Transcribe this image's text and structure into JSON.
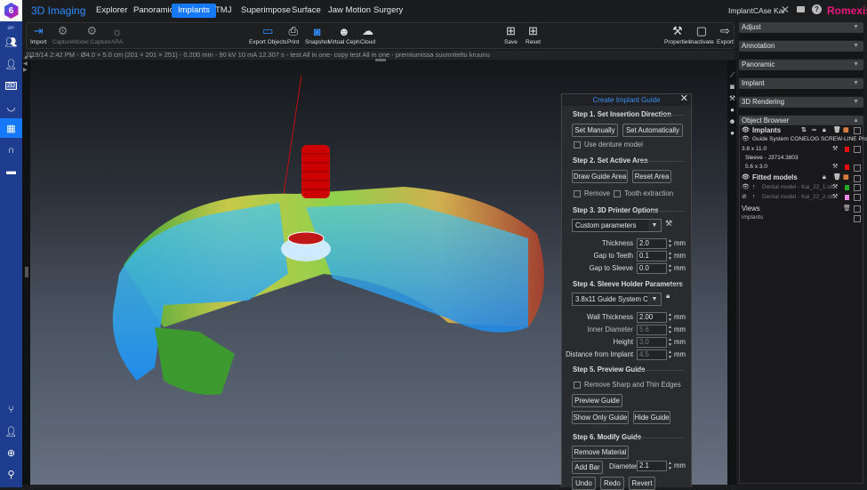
{
  "app": {
    "title": "3D Imaging",
    "case_name": "ImplantCAse Kai",
    "brand": "Romexis",
    "accent_color": "#1677ff",
    "brand_color": "#e8177d"
  },
  "nav_tabs": [
    {
      "label": "Explorer",
      "active": false
    },
    {
      "label": "Panoramic",
      "active": false
    },
    {
      "label": "Implants",
      "active": true
    },
    {
      "label": "TMJ",
      "active": false
    },
    {
      "label": "Superimpose",
      "active": false
    },
    {
      "label": "Surface",
      "active": false
    },
    {
      "label": "Jaw Motion",
      "active": false
    },
    {
      "label": "Surgery",
      "active": false
    }
  ],
  "rail_icons": [
    "lock-icon",
    "patients-icon",
    "patient-icon",
    "2d-icon",
    "panoramic-icon",
    "3d-icon",
    "arch-icon",
    "model-icon",
    "chair-icon",
    "doctor-icon",
    "login-icon",
    "user-settings-icon"
  ],
  "toolbar": {
    "left": [
      {
        "label": "Import",
        "icon": "import-icon",
        "enabled": true
      },
      {
        "label": "Capture",
        "icon": "capture-icon",
        "enabled": false
      },
      {
        "label": "Model Capture",
        "icon": "model-capture-icon",
        "enabled": false
      },
      {
        "label": "ARA",
        "icon": "ara-icon",
        "enabled": false
      }
    ],
    "middle": [
      {
        "label": "Export Objects",
        "icon": "export-objects-icon"
      },
      {
        "label": "Print",
        "icon": "print-icon"
      },
      {
        "label": "Snapshot",
        "icon": "snapshot-icon"
      },
      {
        "label": "Virtual Ceph",
        "icon": "virtual-ceph-icon"
      },
      {
        "label": "Cloud",
        "icon": "cloud-icon"
      }
    ],
    "save": {
      "label": "Save"
    },
    "reset": {
      "label": "Reset"
    },
    "right": [
      {
        "label": "Properties",
        "icon": "properties-icon"
      },
      {
        "label": "Inactivate",
        "icon": "inactivate-icon"
      },
      {
        "label": "Export",
        "icon": "export-icon"
      }
    ]
  },
  "info_line": "2/19/14 2:42 PM - Ø4.0 × 5.0 cm (201 × 201 × 251) - 0.200 mm - 90 kV 10 mA 12.307 s - test All in one- copy test All in one - premiumissa suunniteltu kruunu",
  "dialog": {
    "title": "Create Implant Guide",
    "step1": {
      "title": "Step 1. Set Insertion Direction",
      "set_manually": "Set Manually",
      "set_automatically": "Set Automatically",
      "use_denture_model": "Use denture model",
      "use_denture_checked": false
    },
    "step2": {
      "title": "Step 2. Set Active Area",
      "draw_guide_area": "Draw Guide Area",
      "reset_area": "Reset Area",
      "remove": "Remove",
      "remove_checked": false,
      "tooth_extraction": "Tooth extraction",
      "tooth_extraction_checked": false
    },
    "step3": {
      "title": "Step 3. 3D Printer Options",
      "preset": "Custom parameters",
      "params": [
        {
          "label": "Thickness",
          "value": "2.0",
          "unit": "mm"
        },
        {
          "label": "Gap to Teeth",
          "value": "0.1",
          "unit": "mm"
        },
        {
          "label": "Gap to Sleeve",
          "value": "0.0",
          "unit": "mm"
        }
      ]
    },
    "step4": {
      "title": "Step 4. Sleeve Holder Parameters",
      "preset": "3.8x11 Guide System C...",
      "params": [
        {
          "label": "Wall Thickness",
          "value": "2.00",
          "unit": "mm",
          "enabled": true
        },
        {
          "label": "Inner Diameter",
          "value": "5.6",
          "unit": "mm",
          "enabled": false
        },
        {
          "label": "Height",
          "value": "3.0",
          "unit": "mm",
          "enabled": false
        },
        {
          "label": "Distance from Implant",
          "value": "4.5",
          "unit": "mm",
          "enabled": false
        }
      ]
    },
    "step5": {
      "title": "Step 5. Preview Guide",
      "remove_sharp": "Remove Sharp and Thin Edges",
      "remove_sharp_checked": false,
      "preview_guide": "Preview Guide",
      "show_only_guide": "Show Only Guide",
      "hide_guide": "Hide Guide"
    },
    "step6": {
      "title": "Step 6. Modify Guide",
      "remove_material": "Remove Material",
      "add_bar": "Add Bar",
      "diameter_label": "Diameter",
      "diameter_value": "2.1",
      "diameter_unit": "mm",
      "undo": "Undo",
      "redo": "Redo",
      "revert": "Revert"
    }
  },
  "right_panel": {
    "accordions": [
      {
        "label": "Adjust",
        "expanded": false
      },
      {
        "label": "Annotation",
        "expanded": false
      },
      {
        "label": "Panoramic",
        "expanded": false
      },
      {
        "label": "Implant",
        "expanded": false
      },
      {
        "label": "3D Rendering",
        "expanded": false
      }
    ],
    "object_browser": {
      "title": "Object Browser",
      "implants_group": "Implants",
      "implant_name": "Guide System CONELOG SCREW-LINE Pro...",
      "implant_size": "3.8 x 11.0",
      "implant_color": "#ff0000",
      "sleeve_name": "Sleeve - J3714.3803",
      "sleeve_size": "5.6 x 3.0",
      "sleeve_color": "#ff0000",
      "fitted_group": "Fitted models",
      "models": [
        {
          "name": "Dental model - Kai_22_1.stl",
          "color": "#22aa22",
          "visible": true
        },
        {
          "name": "Dental model - Kai_22_2.stl",
          "color": "#ff88ee",
          "visible": false
        }
      ],
      "views_group": "Views",
      "views": [
        "implants"
      ]
    }
  }
}
